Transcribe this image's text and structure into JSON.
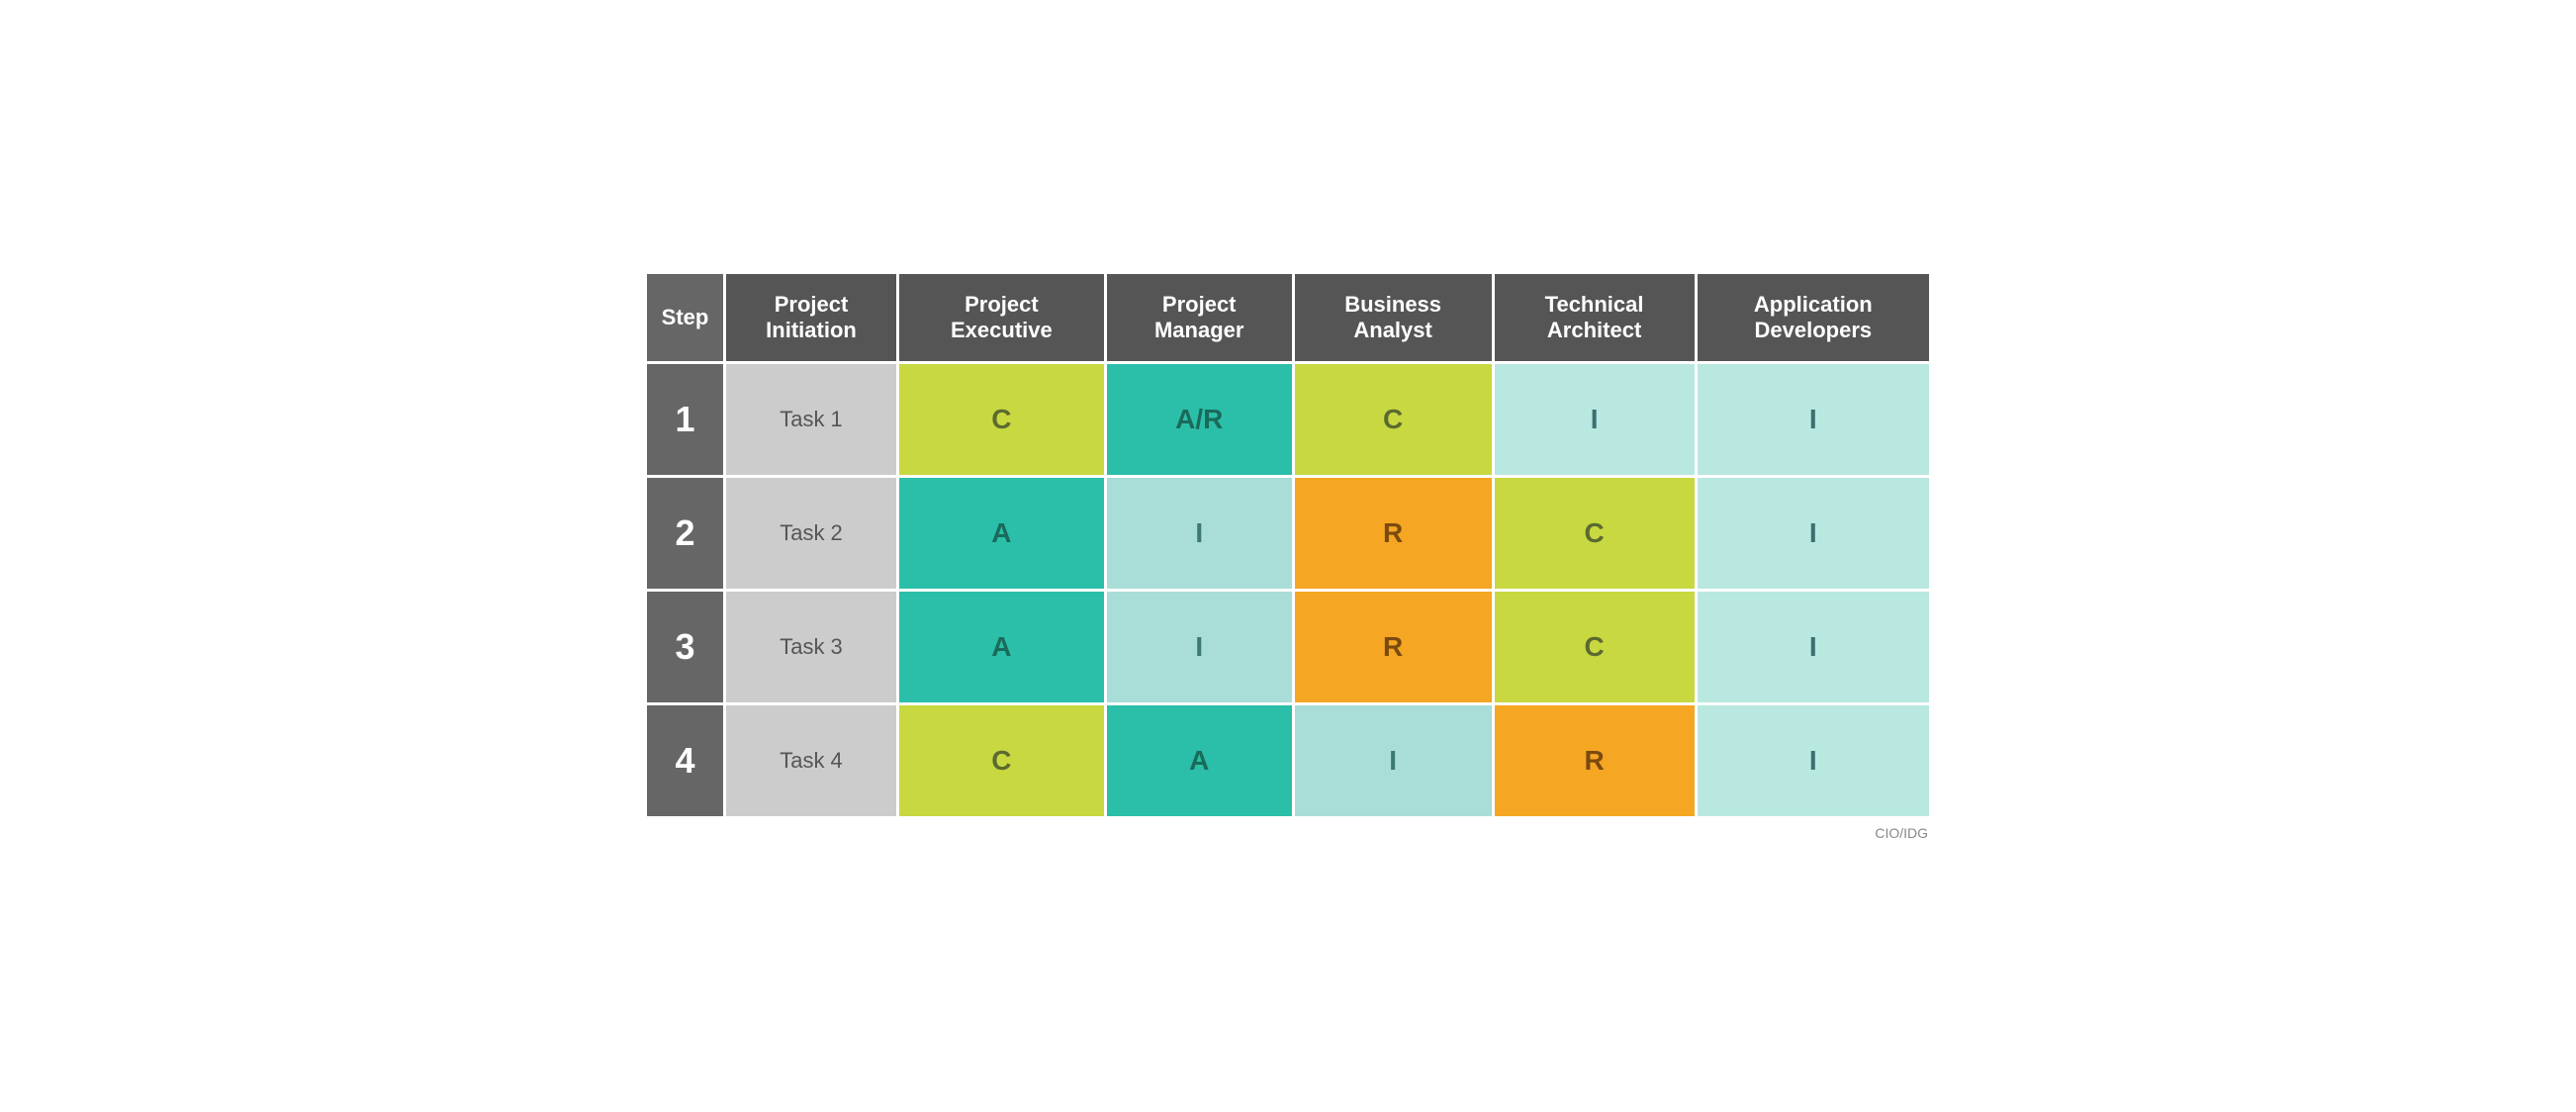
{
  "table": {
    "headers": [
      {
        "id": "step",
        "label": "Step"
      },
      {
        "id": "project-initiation",
        "label": "Project\nInitiation"
      },
      {
        "id": "project-executive",
        "label": "Project\nExecutive"
      },
      {
        "id": "project-manager",
        "label": "Project\nManager"
      },
      {
        "id": "business-analyst",
        "label": "Business\nAnalyst"
      },
      {
        "id": "technical-architect",
        "label": "Technical\nArchitect"
      },
      {
        "id": "application-developers",
        "label": "Application\nDevelopers"
      }
    ],
    "rows": [
      {
        "step": "1",
        "task": "Task 1",
        "cells": [
          {
            "value": "C",
            "color": "lime"
          },
          {
            "value": "A/R",
            "color": "teal"
          },
          {
            "value": "C",
            "color": "lime"
          },
          {
            "value": "I",
            "color": "mint"
          },
          {
            "value": "I",
            "color": "mint"
          }
        ]
      },
      {
        "step": "2",
        "task": "Task 2",
        "cells": [
          {
            "value": "A",
            "color": "teal"
          },
          {
            "value": "I",
            "color": "teal-light"
          },
          {
            "value": "R",
            "color": "orange"
          },
          {
            "value": "C",
            "color": "lime"
          },
          {
            "value": "I",
            "color": "mint"
          }
        ]
      },
      {
        "step": "3",
        "task": "Task 3",
        "cells": [
          {
            "value": "A",
            "color": "teal"
          },
          {
            "value": "I",
            "color": "teal-light"
          },
          {
            "value": "R",
            "color": "orange"
          },
          {
            "value": "C",
            "color": "lime"
          },
          {
            "value": "I",
            "color": "mint"
          }
        ]
      },
      {
        "step": "4",
        "task": "Task 4",
        "cells": [
          {
            "value": "C",
            "color": "lime"
          },
          {
            "value": "A",
            "color": "teal"
          },
          {
            "value": "I",
            "color": "teal-light"
          },
          {
            "value": "R",
            "color": "orange"
          },
          {
            "value": "I",
            "color": "mint"
          }
        ]
      }
    ],
    "watermark": "CIO/IDG"
  }
}
